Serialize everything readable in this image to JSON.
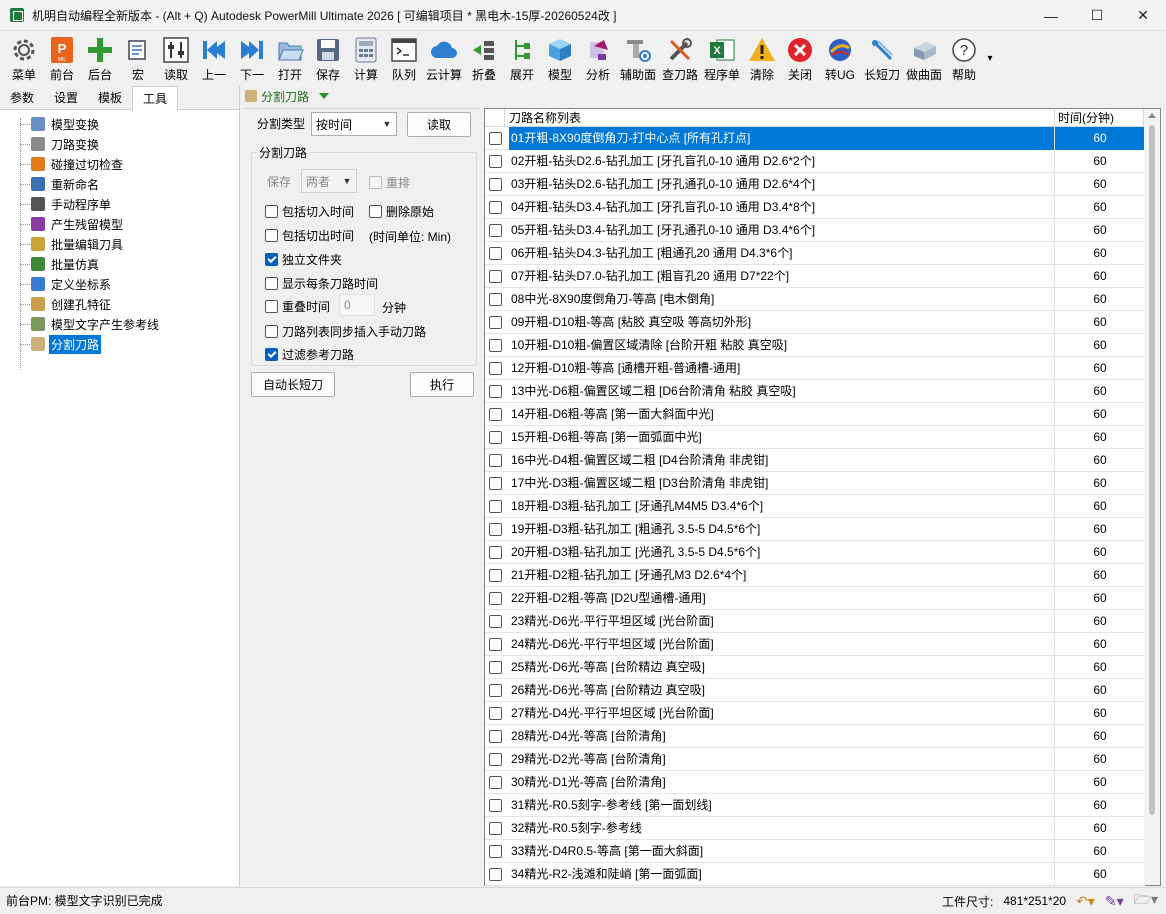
{
  "window": {
    "title": "机明自动编程全新版本 - (Alt + Q) Autodesk PowerMill Ultimate 2026    [ 可编辑项目 * 黑电木-15厚-20260524改 ]",
    "buttons": {
      "minimize": "—",
      "maximize": "☐",
      "close": "✕"
    }
  },
  "toolbar": {
    "items": [
      {
        "label": "菜单",
        "icon": "gear-icon"
      },
      {
        "label": "前台",
        "icon": "powermill-logo-icon"
      },
      {
        "label": "后台",
        "icon": "plus-icon"
      },
      {
        "label": "宏",
        "icon": "macro-icon"
      },
      {
        "label": "读取",
        "icon": "sliders-icon"
      },
      {
        "label": "上一",
        "icon": "previous-icon"
      },
      {
        "label": "下一",
        "icon": "next-icon"
      },
      {
        "label": "打开",
        "icon": "folder-open-icon"
      },
      {
        "label": "保存",
        "icon": "save-icon"
      },
      {
        "label": "计算",
        "icon": "calculator-icon"
      },
      {
        "label": "队列",
        "icon": "terminal-icon"
      },
      {
        "label": "云计算",
        "icon": "cloud-icon"
      },
      {
        "label": "折叠",
        "icon": "collapse-icon"
      },
      {
        "label": "展开",
        "icon": "expand-tree-icon"
      },
      {
        "label": "模型",
        "icon": "cube-icon"
      },
      {
        "label": "分析",
        "icon": "analysis-icon"
      },
      {
        "label": "辅助面",
        "icon": "aux-surface-icon"
      },
      {
        "label": "查刀路",
        "icon": "tools-icon"
      },
      {
        "label": "程序单",
        "icon": "excel-icon"
      },
      {
        "label": "清除",
        "icon": "warning-icon"
      },
      {
        "label": "关闭",
        "icon": "close-circle-icon"
      },
      {
        "label": "转UG",
        "icon": "ug-icon"
      },
      {
        "label": "长短刀",
        "icon": "long-short-tool-icon"
      },
      {
        "label": "做曲面",
        "icon": "surface-icon"
      },
      {
        "label": "帮助",
        "icon": "help-icon"
      }
    ],
    "more": "▾"
  },
  "left_panel": {
    "tabs": [
      "参数",
      "设置",
      "模板",
      "工具"
    ],
    "active_tab": "工具",
    "tree": [
      {
        "label": "模型变换",
        "icon": "model-transform-icon",
        "color": "#6a8fc2"
      },
      {
        "label": "刀路变换",
        "icon": "toolpath-transform-icon",
        "color": "#8a8a8a"
      },
      {
        "label": "碰撞过切检查",
        "icon": "collision-check-icon",
        "color": "#e07a1a"
      },
      {
        "label": "重新命名",
        "icon": "rename-icon",
        "color": "#3a6fb0"
      },
      {
        "label": "手动程序单",
        "icon": "manual-sheet-icon",
        "color": "#555555"
      },
      {
        "label": "产生残留模型",
        "icon": "stock-model-icon",
        "color": "#8a3aa0"
      },
      {
        "label": "批量编辑刀具",
        "icon": "batch-tool-icon",
        "color": "#c9a23a"
      },
      {
        "label": "批量仿真",
        "icon": "batch-simulate-icon",
        "color": "#3a8a3a"
      },
      {
        "label": "定义坐标系",
        "icon": "workplane-icon",
        "color": "#3a7ad0"
      },
      {
        "label": "创建孔特征",
        "icon": "hole-feature-icon",
        "color": "#c8a04a"
      },
      {
        "label": "模型文字产生参考线",
        "icon": "text-pattern-icon",
        "color": "#7a9a5a"
      },
      {
        "label": "分割刀路",
        "icon": "split-toolpath-icon",
        "color": "#c9b37a"
      }
    ],
    "selected": "分割刀路"
  },
  "split_panel": {
    "header": "分割刀路",
    "split_type_label": "分割类型",
    "split_type_value": "按时间",
    "read_button": "读取",
    "group_title": "分割刀路",
    "save_label": "保存",
    "save_value": "两者",
    "reorder_label": "重排",
    "include_in_time": "包括切入时间",
    "delete_original": "删除原始",
    "include_out_time": "包括切出时间",
    "time_unit": "(时间单位: Min)",
    "independent_folder": "独立文件夹",
    "show_each_time": "显示每条刀路时间",
    "overlap_time": "重叠时间",
    "overlap_value": "0",
    "minutes": "分钟",
    "sync_insert": "刀路列表同步插入手动刀路",
    "filter_reference": "过滤参考刀路",
    "auto_long_short": "自动长短刀",
    "execute": "执行",
    "checks": {
      "reorder": false,
      "include_in_time": false,
      "delete_original": false,
      "include_out_time": false,
      "independent_folder": true,
      "show_each_time": false,
      "overlap_time": false,
      "sync_insert": false,
      "filter_reference": true
    }
  },
  "toolpath_table": {
    "columns": [
      "刀路名称列表",
      "时间(分钟)"
    ],
    "rows": [
      {
        "name": "01开粗-8X90度倒角刀-打中心点 [所有孔打点]",
        "time": "60",
        "selected": true
      },
      {
        "name": "02开粗-钻头D2.6-钻孔加工 [牙孔盲孔0-10 通用 D2.6*2个]",
        "time": "60"
      },
      {
        "name": "03开粗-钻头D2.6-钻孔加工 [牙孔通孔0-10 通用 D2.6*4个]",
        "time": "60"
      },
      {
        "name": "04开粗-钻头D3.4-钻孔加工 [牙孔盲孔0-10 通用 D3.4*8个]",
        "time": "60"
      },
      {
        "name": "05开粗-钻头D3.4-钻孔加工 [牙孔通孔0-10 通用 D3.4*6个]",
        "time": "60"
      },
      {
        "name": "06开粗-钻头D4.3-钻孔加工 [粗通孔20 通用 D4.3*6个]",
        "time": "60"
      },
      {
        "name": "07开粗-钻头D7.0-钻孔加工 [粗盲孔20 通用 D7*22个]",
        "time": "60"
      },
      {
        "name": "08中光-8X90度倒角刀-等高 [电木倒角]",
        "time": "60"
      },
      {
        "name": "09开粗-D10粗-等高 [粘胶 真空吸 等高切外形]",
        "time": "60"
      },
      {
        "name": "10开粗-D10粗-偏置区域清除 [台阶开粗 粘胶 真空吸]",
        "time": "60"
      },
      {
        "name": "12开粗-D10粗-等高 [通槽开粗-普通槽-通用]",
        "time": "60"
      },
      {
        "name": "13中光-D6粗-偏置区域二粗 [D6台阶清角 粘胶 真空吸]",
        "time": "60"
      },
      {
        "name": "14开粗-D6粗-等高 [第一面大斜面中光]",
        "time": "60"
      },
      {
        "name": "15开粗-D6粗-等高 [第一面弧面中光]",
        "time": "60"
      },
      {
        "name": "16中光-D4粗-偏置区域二粗 [D4台阶清角 非虎钳]",
        "time": "60"
      },
      {
        "name": "17中光-D3粗-偏置区域二粗 [D3台阶清角 非虎钳]",
        "time": "60"
      },
      {
        "name": "18开粗-D3粗-钻孔加工 [牙通孔M4M5 D3.4*6个]",
        "time": "60"
      },
      {
        "name": "19开粗-D3粗-钻孔加工 [粗通孔 3.5-5 D4.5*6个]",
        "time": "60"
      },
      {
        "name": "20开粗-D3粗-钻孔加工 [光通孔 3.5-5 D4.5*6个]",
        "time": "60"
      },
      {
        "name": "21开粗-D2粗-钻孔加工 [牙通孔M3 D2.6*4个]",
        "time": "60"
      },
      {
        "name": "22开粗-D2粗-等高 [D2U型通槽-通用]",
        "time": "60"
      },
      {
        "name": "23精光-D6光-平行平坦区域 [光台阶面]",
        "time": "60"
      },
      {
        "name": "24精光-D6光-平行平坦区域 [光台阶面]",
        "time": "60"
      },
      {
        "name": "25精光-D6光-等高 [台阶精边 真空吸]",
        "time": "60"
      },
      {
        "name": "26精光-D6光-等高 [台阶精边 真空吸]",
        "time": "60"
      },
      {
        "name": "27精光-D4光-平行平坦区域 [光台阶面]",
        "time": "60"
      },
      {
        "name": "28精光-D4光-等高 [台阶清角]",
        "time": "60"
      },
      {
        "name": "29精光-D2光-等高 [台阶清角]",
        "time": "60"
      },
      {
        "name": "30精光-D1光-等高 [台阶清角]",
        "time": "60"
      },
      {
        "name": "31精光-R0.5刻字-参考线 [第一面划线]",
        "time": "60"
      },
      {
        "name": "32精光-R0.5刻字-参考线",
        "time": "60"
      },
      {
        "name": "33精光-D4R0.5-等高 [第一面大斜面]",
        "time": "60"
      },
      {
        "name": "34精光-R2-浅滩和陡峭 [第一面弧面]",
        "time": "60"
      }
    ]
  },
  "status": {
    "message": "前台PM: 模型文字识别已完成",
    "workpiece_label": "工件尺寸:",
    "workpiece_size": "481*251*20"
  },
  "colors": {
    "selection": "#0078d7",
    "header_green": "#1a6f1a"
  }
}
